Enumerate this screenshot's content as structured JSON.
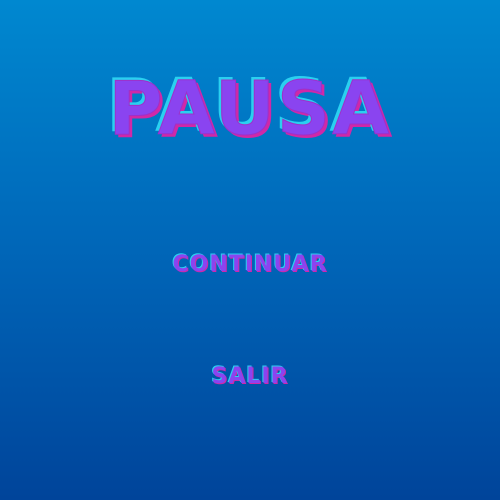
{
  "pause_menu": {
    "title": "PAUSA",
    "continue_label": "CONTINUAR",
    "exit_label": "SALIR"
  },
  "colors": {
    "background_top": "#0088d0",
    "background_bottom": "#00449a",
    "text_fill": "#8a44f0",
    "text_highlight": "#2ad0f0",
    "text_shadow": "#d028a8"
  }
}
